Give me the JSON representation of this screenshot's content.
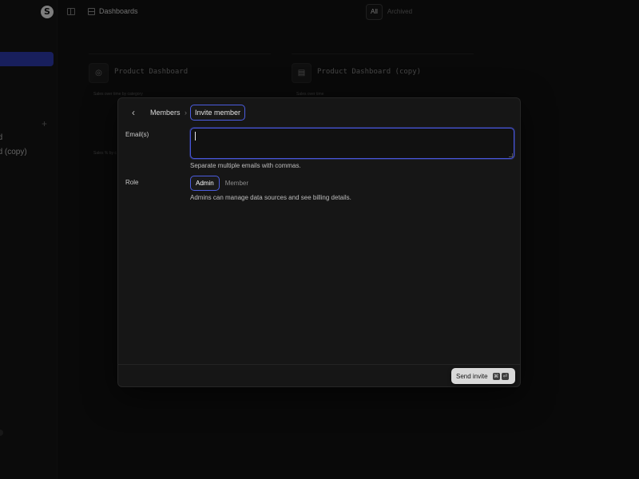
{
  "app": {
    "logo_glyph": "S",
    "sidebar": {
      "items": [
        {
          "label": "hboard"
        },
        {
          "label": "hboard (copy)"
        }
      ],
      "add_glyph": "+"
    },
    "topbar": {
      "breadcrumb": "Dashboards",
      "filter": {
        "all": "All",
        "archived": "Archived",
        "selected": "All"
      }
    },
    "cards": [
      {
        "title": "Product Dashboard",
        "subtitle": "Sales over time by category",
        "subtitle2": "Sales % by c",
        "icon": "globe-icon"
      },
      {
        "title": "Product Dashboard (copy)",
        "subtitle": "Sales over time",
        "icon": "grid-icon"
      }
    ]
  },
  "modal": {
    "breadcrumb": {
      "parent": "Members",
      "separator": "›",
      "current": "Invite member"
    },
    "email": {
      "label": "Email(s)",
      "value": "",
      "placeholder": "",
      "hint": "Separate multiple emails with commas."
    },
    "role": {
      "label": "Role",
      "options": [
        "Admin",
        "Member"
      ],
      "selected": "Admin",
      "hint": "Admins can manage data sources and see billing details."
    },
    "send": {
      "label": "Send invite",
      "shortcut": [
        "⌘",
        "⏎"
      ]
    }
  },
  "colors": {
    "accent": "#4c5de0",
    "sidebar_active": "#2d3aa8",
    "button_bg": "#d9d9d9"
  }
}
